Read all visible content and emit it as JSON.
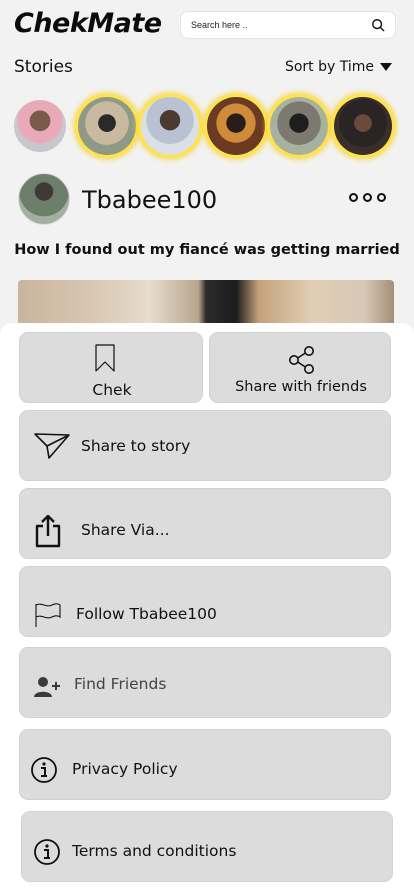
{
  "app": {
    "name": "ChekMate"
  },
  "search": {
    "placeholder": "Search here .."
  },
  "stories": {
    "title": "Stories",
    "sort_label": "Sort by Time"
  },
  "post": {
    "username": "Tbabee100",
    "title": "How I found out my fiancé was getting married"
  },
  "sheet": {
    "chek_label": "Chek",
    "share_friends_label": "Share with friends",
    "share_story_label": "Share to story",
    "share_via_label": "Share Via...",
    "follow_label": "Follow Tbabee100",
    "find_friends_label": "Find Friends",
    "privacy_label": "Privacy Policy",
    "terms_label": "Terms and conditions"
  },
  "colors": {
    "story_ring": "#ffe34d",
    "button_bg": "#dcdcdc",
    "sheet_bg": "#ffffff",
    "page_bg": "#f2f2f2"
  },
  "icons": {
    "search": "search-icon",
    "sort": "caret-down-icon",
    "more": "more-dots-icon",
    "chek": "bookmark-icon",
    "share_friends": "share-nodes-icon",
    "share_story": "paper-plane-icon",
    "share_via": "share-upload-icon",
    "follow": "flag-icon",
    "find_friends": "add-user-icon",
    "privacy": "info-icon",
    "terms": "info-icon"
  }
}
